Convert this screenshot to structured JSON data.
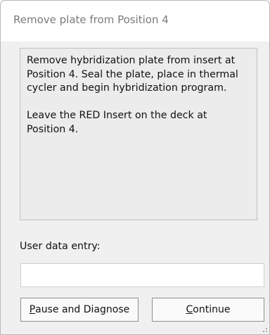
{
  "dialog": {
    "title": "Remove plate from Position 4",
    "message_paragraphs": [
      "Remove hybridization plate from insert at\nPosition 4. Seal the plate, place in thermal\ncycler and begin hybridization program.",
      "Leave the RED Insert on the deck at\nPosition 4."
    ]
  },
  "entry": {
    "label": "User data entry:",
    "value": "",
    "placeholder": ""
  },
  "buttons": {
    "pause": {
      "mnemonic": "P",
      "rest": "ause and Diagnose"
    },
    "continue": {
      "mnemonic": "C",
      "rest": "ontinue"
    }
  },
  "icons": {
    "resize_grip": "resize-grip-icon"
  }
}
